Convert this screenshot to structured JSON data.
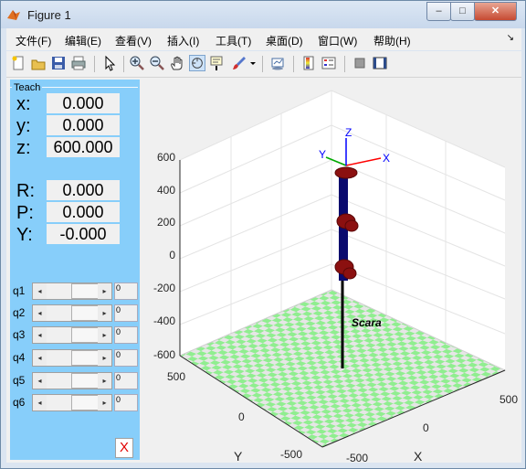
{
  "window": {
    "title": "Figure 1",
    "minimize_label": "–",
    "maximize_label": "□",
    "close_label": "✕"
  },
  "menu": {
    "items": [
      "文件(F)",
      "编辑(E)",
      "查看(V)",
      "插入(I)",
      "工具(T)",
      "桌面(D)",
      "窗口(W)",
      "帮助(H)"
    ],
    "overflow_arrow": "↘"
  },
  "toolbar": {
    "icons": [
      "new-figure-icon",
      "open-file-icon",
      "save-icon",
      "print-icon",
      "edit-plot-arrow-icon",
      "zoom-in-icon",
      "zoom-out-icon",
      "pan-hand-icon",
      "rotate-3d-icon",
      "data-cursor-icon",
      "brush-icon",
      "brush-dropdown-icon",
      "link-plot-icon",
      "colorbar-icon",
      "legend-icon",
      "hide-plot-tools-icon",
      "show-plot-tools-icon"
    ]
  },
  "teach": {
    "title": "Teach",
    "x_label": "x:",
    "x_value": "0.000",
    "y_label": "y:",
    "y_value": "0.000",
    "z_label": "z:",
    "z_value": "600.000",
    "r_label": "R:",
    "r_value": "0.000",
    "p_label": "P:",
    "p_value": "0.000",
    "yaw_label": "Y:",
    "yaw_value": "-0.000",
    "joints": [
      {
        "label": "q1",
        "value": "0"
      },
      {
        "label": "q2",
        "value": "0"
      },
      {
        "label": "q3",
        "value": "0"
      },
      {
        "label": "q4",
        "value": "0"
      },
      {
        "label": "q5",
        "value": "0"
      },
      {
        "label": "q6",
        "value": "0"
      }
    ],
    "close_label": "X",
    "slider_left": "◂",
    "slider_right": "▸"
  },
  "plot": {
    "robot_name": "Scara",
    "z_ticks": [
      "600",
      "400",
      "200",
      "0",
      "-200",
      "-400",
      "-600"
    ],
    "y_ticks": [
      "500",
      "0",
      "-500"
    ],
    "x_ticks": [
      "500",
      "0",
      "-500"
    ],
    "y_axis_label": "Y",
    "x_axis_label": "X",
    "frame_labels": {
      "x": "X",
      "y": "Y",
      "z": "Z"
    },
    "colors": {
      "link": "#0a0a6e",
      "joint": "#8b1010",
      "floor_light": "#90ee90",
      "floor_alt": "#e6e6e6"
    }
  }
}
